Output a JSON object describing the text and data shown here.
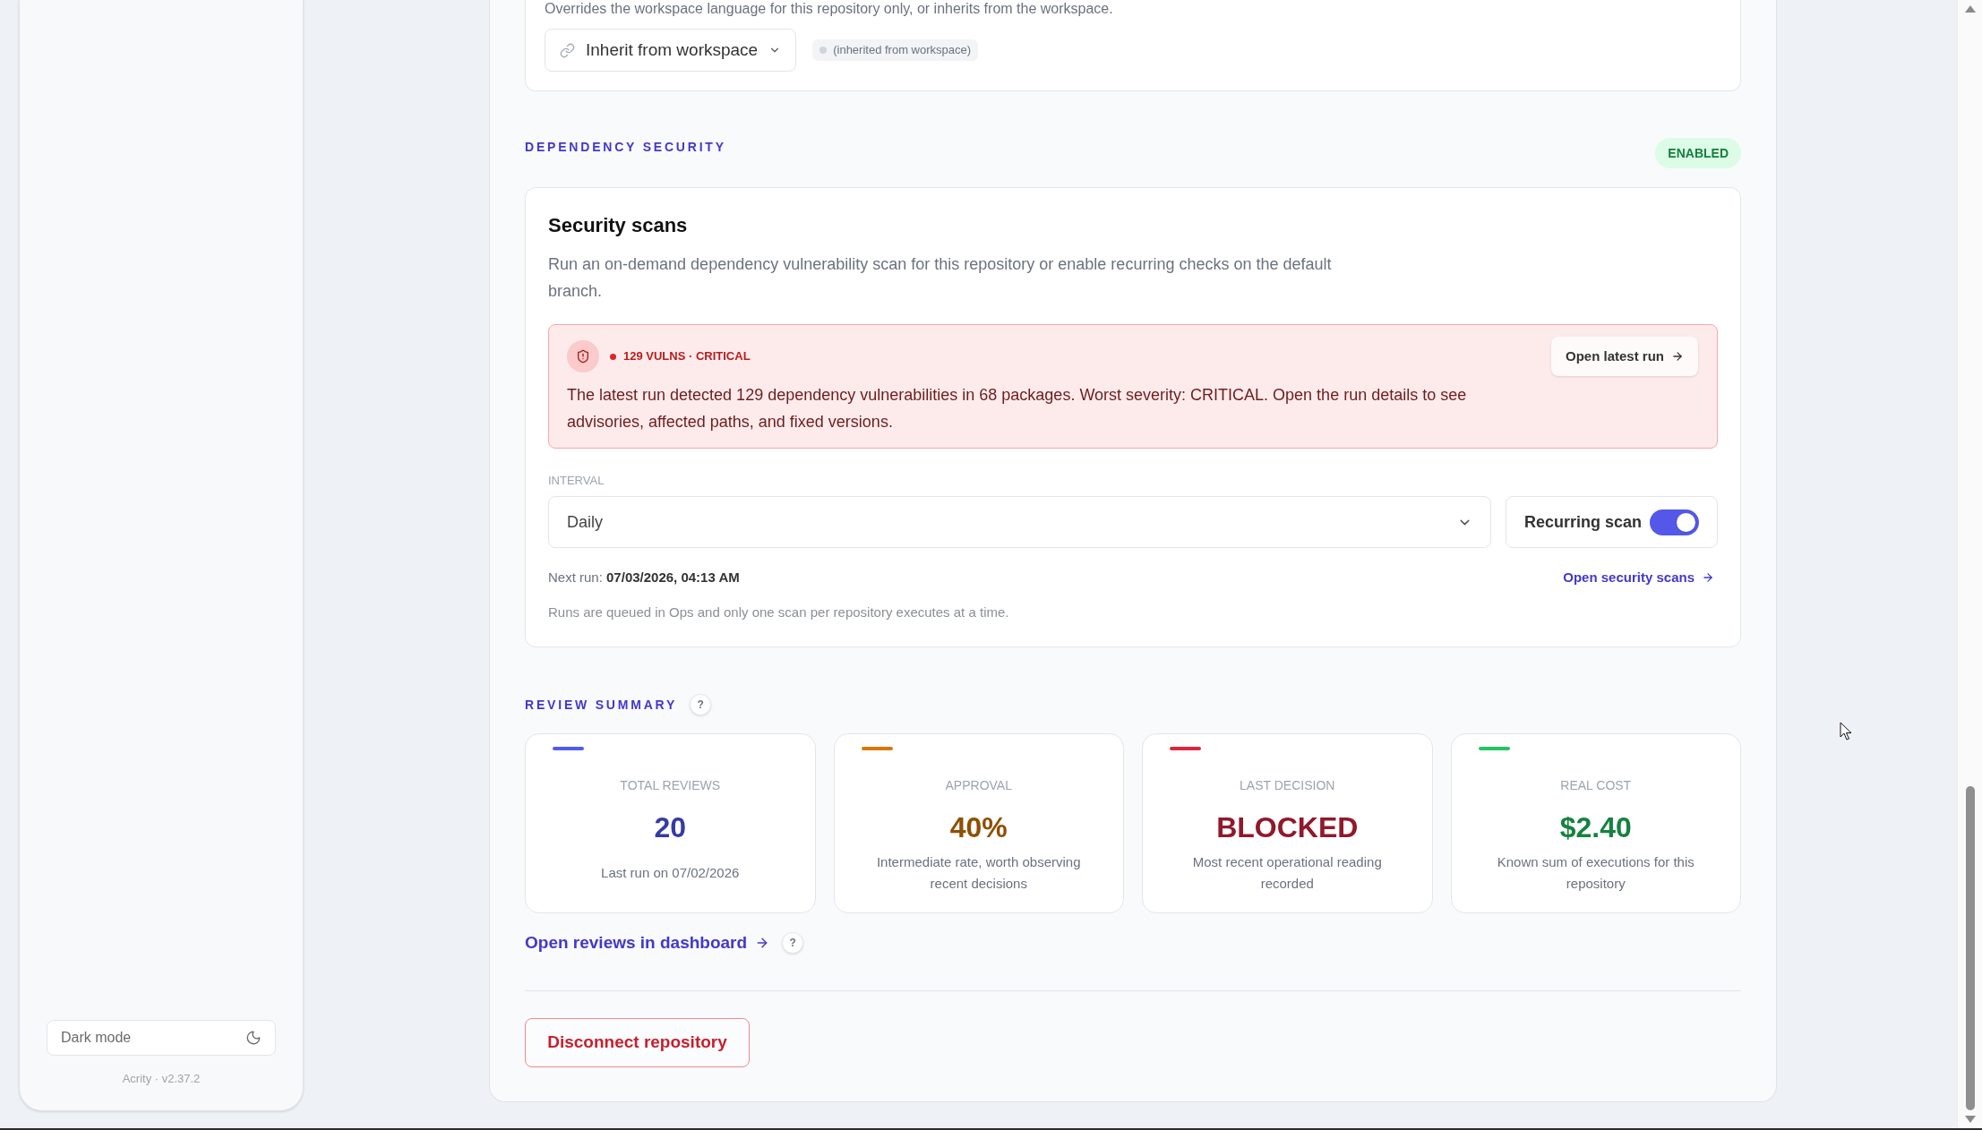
{
  "language_setting": {
    "description": "Overrides the workspace language for this repository only, or inherits from the workspace.",
    "select": {
      "value": "Inherit from workspace"
    },
    "badge": "(inherited from workspace)"
  },
  "dependency_security": {
    "heading": "DEPENDENCY SECURITY",
    "status": "ENABLED",
    "title": "Security scans",
    "description": "Run an on-demand dependency vulnerability scan for this repository or enable recurring checks on the default branch.",
    "alert": {
      "badge": "129 VULNS · CRITICAL",
      "message": "The latest run detected 129 dependency vulnerabilities in 68 packages. Worst severity: CRITICAL. Open the run details to see advisories, affected paths, and fixed versions.",
      "button": "Open latest run"
    },
    "interval": {
      "label": "INTERVAL",
      "value": "Daily"
    },
    "recurring_scan": {
      "label": "Recurring scan",
      "on": true
    },
    "next_run": "Next run: **07/03/2026, 04:13 AM**",
    "link": "Open security scans",
    "note": "Runs are queued in Ops and only one scan per repository executes at a time."
  },
  "review_summary": {
    "heading": "REVIEW SUMMARY",
    "help": "?",
    "stats": [
      {
        "label": "TOTAL REVIEWS",
        "value": "20",
        "description": "Last run on 07/02/2026",
        "color": "#4f5bf5"
      },
      {
        "label": "APPROVAL",
        "value": "40%",
        "description": "Intermediate rate, worth observing recent decisions",
        "color": "#d97706"
      },
      {
        "label": "LAST DECISION",
        "value": "BLOCKED",
        "description": "Most recent operational reading recorded",
        "color": "#dc2640"
      },
      {
        "label": "REAL COST",
        "value": "$2.40",
        "description": "Known sum of executions for this repository",
        "color": "#22c55e"
      }
    ],
    "link": "Open reviews in dashboard",
    "link_help": "?"
  },
  "disconnect_button": "Disconnect repository",
  "sidebar": {
    "dark_mode": "Dark mode",
    "version": "Acrity · v2.37.2"
  }
}
